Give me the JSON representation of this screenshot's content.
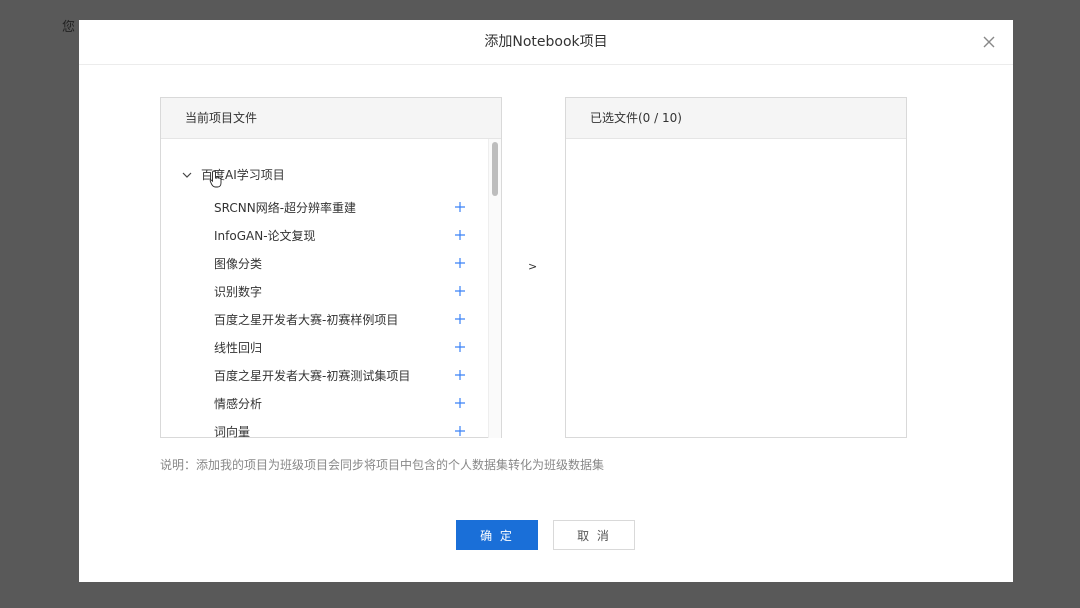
{
  "background": {
    "partial_text": "您"
  },
  "dialog": {
    "title": "添加Notebook项目",
    "close_icon": "close-icon"
  },
  "left_panel": {
    "header": "当前项目文件",
    "root": {
      "label": "百度AI学习项目",
      "expanded": true
    },
    "items": [
      {
        "label": "SRCNN网络-超分辨率重建"
      },
      {
        "label": "InfoGAN-论文复现"
      },
      {
        "label": "图像分类"
      },
      {
        "label": "识别数字"
      },
      {
        "label": "百度之星开发者大赛-初赛样例项目"
      },
      {
        "label": "线性回归"
      },
      {
        "label": "百度之星开发者大赛-初赛测试集项目"
      },
      {
        "label": "情感分析"
      },
      {
        "label": "词向量"
      }
    ]
  },
  "transfer": {
    "arrow": ">"
  },
  "right_panel": {
    "header": "已选文件(0 / 10)"
  },
  "note": "说明：添加我的项目为班级项目会同步将项目中包含的个人数据集转化为班级数据集",
  "buttons": {
    "ok": "确 定",
    "cancel": "取 消"
  },
  "colors": {
    "primary": "#1a6fd8",
    "plus": "#3b82f6",
    "overlay": "#595959"
  }
}
